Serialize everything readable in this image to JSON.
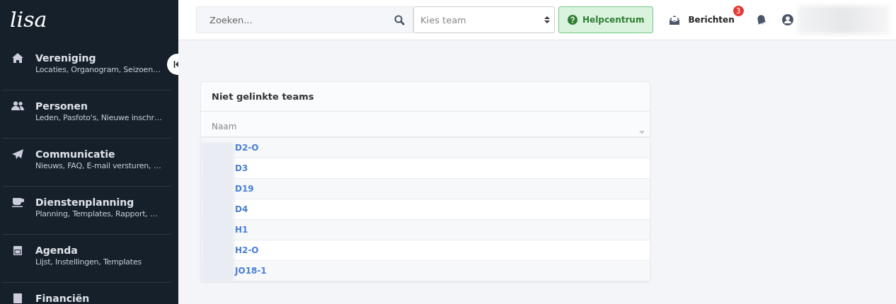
{
  "logo": "lisa",
  "sidebar": {
    "items": [
      {
        "title": "Vereniging",
        "subtitle": "Locaties, Organogram, Seizoen…"
      },
      {
        "title": "Personen",
        "subtitle": "Leden, Pasfoto's, Nieuwe inschr…"
      },
      {
        "title": "Communicatie",
        "subtitle": "Nieuws, FAQ, E-mail versturen, …"
      },
      {
        "title": "Dienstenplanning",
        "subtitle": "Planning, Templates, Rapport, …"
      },
      {
        "title": "Agenda",
        "subtitle": "Lijst, Instellingen, Templates"
      },
      {
        "title": "Financiën"
      }
    ]
  },
  "topbar": {
    "search": {
      "placeholder": "Zoeken..."
    },
    "team_select": {
      "placeholder": "Kies team"
    },
    "help_button": "Helpcentrum",
    "messages": {
      "label": "Berichten",
      "badge": "3"
    }
  },
  "card": {
    "title": "Niet gelinkte teams",
    "columns": [
      "Naam"
    ],
    "rows": [
      "D2-O",
      "D3",
      "D19",
      "D4",
      "H1",
      "H2-O",
      "JO18-1"
    ]
  }
}
